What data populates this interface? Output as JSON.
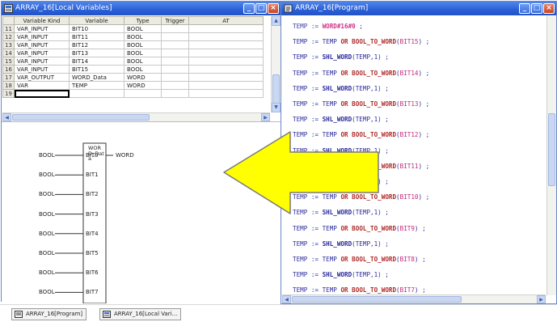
{
  "left_window": {
    "title": "ARRAY_16[Local Variables]",
    "table": {
      "headers": [
        "Variable Kind",
        "Variable",
        "Type",
        "Trigger",
        "AT"
      ],
      "rows": [
        {
          "n": "11",
          "kind": "VAR_INPUT",
          "var": "BIT10",
          "type": "BOOL"
        },
        {
          "n": "12",
          "kind": "VAR_INPUT",
          "var": "BIT11",
          "type": "BOOL"
        },
        {
          "n": "13",
          "kind": "VAR_INPUT",
          "var": "BIT12",
          "type": "BOOL"
        },
        {
          "n": "14",
          "kind": "VAR_INPUT",
          "var": "BIT13",
          "type": "BOOL"
        },
        {
          "n": "15",
          "kind": "VAR_INPUT",
          "var": "BIT14",
          "type": "BOOL"
        },
        {
          "n": "16",
          "kind": "VAR_INPUT",
          "var": "BIT15",
          "type": "BOOL"
        },
        {
          "n": "17",
          "kind": "VAR_OUTPUT",
          "var": "WORD_Data",
          "type": "WORD"
        },
        {
          "n": "18",
          "kind": "VAR",
          "var": "TEMP",
          "type": "WORD"
        },
        {
          "n": "19",
          "kind": "",
          "var": "",
          "type": ""
        }
      ]
    },
    "block": {
      "bool_label": "BOOL",
      "word_label": "WORD",
      "out_pin": "WOR\nD_Dat\na",
      "pins": [
        "BIT0",
        "BIT1",
        "BIT2",
        "BIT3",
        "BIT4",
        "BIT5",
        "BIT6",
        "BIT7"
      ]
    }
  },
  "right_window": {
    "title": "ARRAY_16[Program]",
    "code_lines": [
      {
        "t": "assign",
        "text": "TEMP := WORD#16#0 ;"
      },
      {
        "t": "or",
        "bit": "BIT15"
      },
      {
        "t": "shl"
      },
      {
        "t": "or",
        "bit": "BIT14"
      },
      {
        "t": "shl"
      },
      {
        "t": "or",
        "bit": "BIT13"
      },
      {
        "t": "shl"
      },
      {
        "t": "or",
        "bit": "BIT12"
      },
      {
        "t": "shl"
      },
      {
        "t": "or",
        "bit": "BIT11"
      },
      {
        "t": "shl"
      },
      {
        "t": "or",
        "bit": "BIT10"
      },
      {
        "t": "shl"
      },
      {
        "t": "or",
        "bit": "BIT9"
      },
      {
        "t": "shl"
      },
      {
        "t": "or",
        "bit": "BIT8"
      },
      {
        "t": "shl"
      },
      {
        "t": "or",
        "bit": "BIT7"
      }
    ],
    "tokens": {
      "temp": "TEMP",
      "assign": ":=",
      "or": "OR",
      "bool_to_word": "BOOL_TO_WORD",
      "shl": "SHL_WORD",
      "shl_args": "(TEMP,1)",
      "semi": ";"
    }
  },
  "taskbar": {
    "items": [
      "ARRAY_16[Program]",
      "ARRAY_16[Local Vari..."
    ]
  },
  "colors": {
    "titlebar": "#2a5fd6",
    "arrow_fill": "#ffff00",
    "arrow_stroke": "#7a7a7a",
    "keyword": "#b02a2a",
    "number": "#d2338a"
  }
}
